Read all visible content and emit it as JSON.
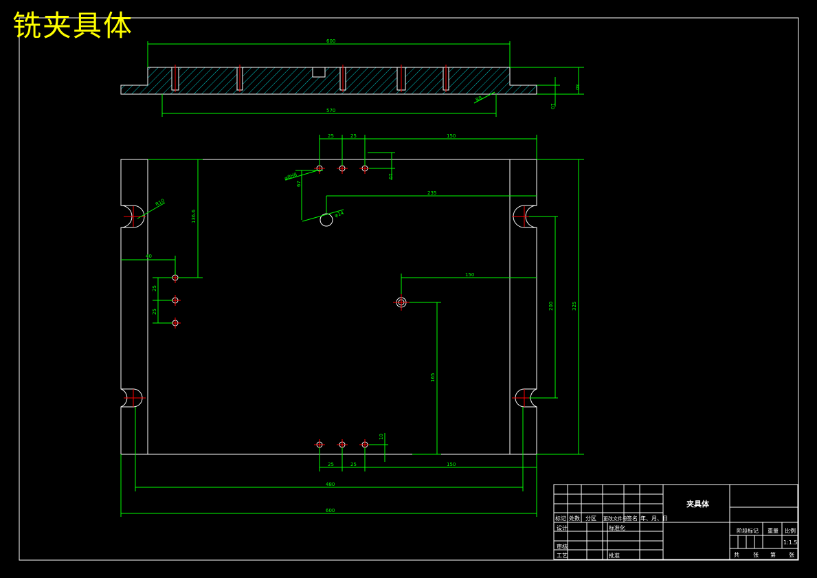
{
  "sheet_title": "铣夹具体",
  "top_view": {
    "dim_length_total": "600",
    "dim_length_inner": "570",
    "dim_height_total": "30",
    "dim_step": "10",
    "dim_chamfer": "R8"
  },
  "plan_view": {
    "dim_hole_pitch_1": "25",
    "dim_hole_pitch_2": "25",
    "dim_right_offset_top": "150",
    "dim_small_hole": "φ8H8",
    "dim_top_row_offset": "10",
    "dim_center_hole_dy": "67",
    "dim_center_hole_dx": "235",
    "dim_center_hole_dia": "φ14",
    "dim_slot_radius": "R10",
    "dim_left_row_y": "136.6",
    "dim_left_row_x": "40",
    "dim_left_pitch_1": "25",
    "dim_left_pitch_2": "25",
    "dim_pin_dx": "150",
    "dim_pin_dy": "165",
    "dim_slot_spacing": "200",
    "dim_total_height": "325",
    "dim_bottom_pitch_1": "25",
    "dim_bottom_pitch_2": "25",
    "dim_bottom_right_offset": "150",
    "dim_bottom_row_offset": "10",
    "dim_width_inner": "480",
    "dim_width_total": "600"
  },
  "title_block": {
    "part_name": "夹具体",
    "headers": [
      "标记",
      "处数",
      "分区",
      "更改文件号",
      "签名",
      "年、月、日"
    ],
    "design": "设计",
    "standardization": "标准化",
    "review": "审核",
    "process": "工艺",
    "approve": "批准",
    "stage_mark": "阶段标记",
    "weight": "重量",
    "scale_label": "比例",
    "scale_value": "1:1.5",
    "sheets_total_prefix": "共",
    "sheets_total_suffix": "张",
    "sheet_no_prefix": "第",
    "sheet_no_suffix": "张"
  },
  "colors": {
    "background": "#000000",
    "outline": "#ffffff",
    "dimension": "#00ff00",
    "centerline": "#ff0000",
    "hatch": "#00c8c8",
    "title": "#ffff00"
  }
}
